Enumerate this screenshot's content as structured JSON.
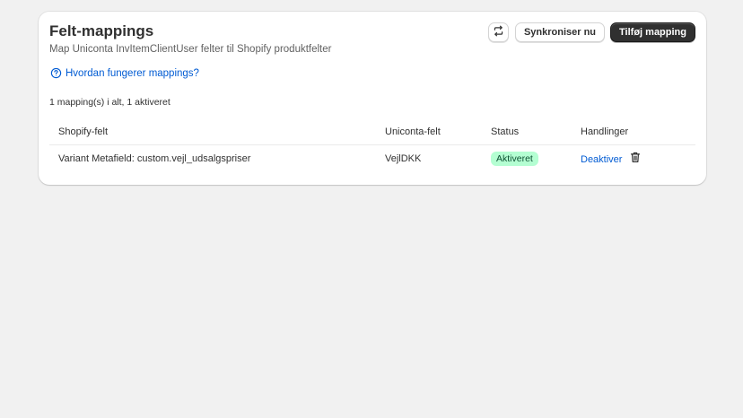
{
  "card": {
    "title": "Felt-mappings",
    "subtitle": "Map Uniconta InvItemClientUser felter til Shopify produktfelter"
  },
  "header_actions": {
    "refresh_icon": "refresh-icon",
    "sync_label": "Synkroniser nu",
    "add_label": "Tilføj mapping"
  },
  "help": {
    "icon": "question-circle-icon",
    "label": "Hvordan fungerer mappings?"
  },
  "summary": "1 mapping(s) i alt, 1 aktiveret",
  "table": {
    "columns": [
      "Shopify-felt",
      "Uniconta-felt",
      "Status",
      "Handlinger"
    ],
    "rows": [
      {
        "shopify_field": "Variant Metafield: custom.vejl_udsalgspriser",
        "uniconta_field": "VejlDKK",
        "status": "Aktiveret",
        "action_label": "Deaktiver",
        "delete_icon": "trash-icon"
      }
    ]
  },
  "colors": {
    "page_bg": "#f1f1f1",
    "card_bg": "#ffffff",
    "primary_button": "#303030",
    "link": "#005bd3",
    "badge_bg": "#b4fed2",
    "badge_text": "#0c5132"
  }
}
